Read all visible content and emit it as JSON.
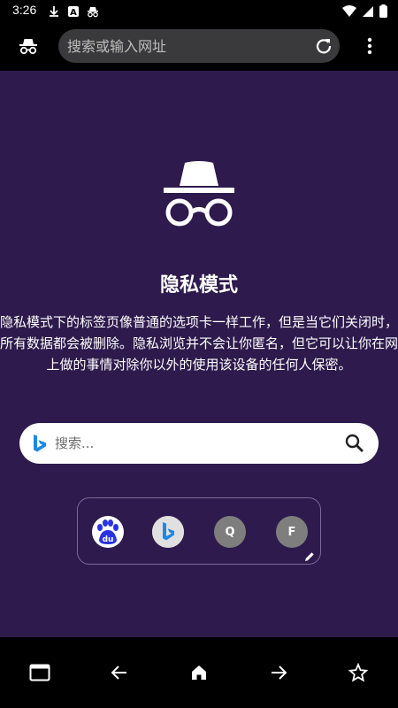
{
  "status_bar": {
    "time": "3:26",
    "left_icons": [
      "download-icon",
      "notification-a-icon",
      "incognito-small-icon"
    ],
    "right_icons": [
      "wifi-icon",
      "signal-icon",
      "battery-icon"
    ]
  },
  "toolbar": {
    "incognito_icon": "incognito-icon",
    "url_placeholder": "搜索或输入网址",
    "refresh_icon": "refresh-icon",
    "menu_icon": "more-vert-icon"
  },
  "incognito_page": {
    "title": "隐私模式",
    "description": "隐私模式下的标签页像普通的选项卡一样工作，但是当它们关闭时，所有数据都会被删除。隐私浏览并不会让你匿名，但它可以让你在网上做的事情对除你以外的使用该设备的任何人保密。"
  },
  "search": {
    "placeholder": "搜索...",
    "engine_icon": "bing-icon",
    "submit_icon": "search-icon"
  },
  "shortcuts": [
    {
      "name": "baidu",
      "icon": "baidu-icon",
      "label": "du"
    },
    {
      "name": "bing",
      "icon": "bing-icon",
      "label": ""
    },
    {
      "name": "q",
      "icon": "letter-q-icon",
      "label": "Q"
    },
    {
      "name": "f",
      "icon": "letter-f-icon",
      "label": "F"
    }
  ],
  "shortcuts_edit_icon": "edit-icon",
  "bottom_nav": [
    "tabs-icon",
    "back-icon",
    "home-icon",
    "forward-icon",
    "bookmark-icon"
  ],
  "colors": {
    "background": "#2e1a4c",
    "url_bar": "#3a3a3c",
    "baidu_blue": "#2932e1",
    "bing_blue": "#1e88e5"
  }
}
